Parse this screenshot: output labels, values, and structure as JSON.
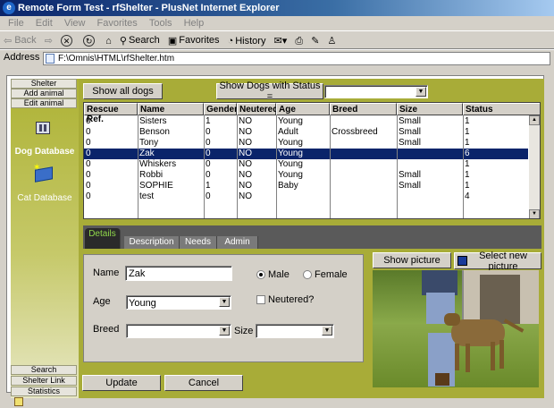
{
  "window": {
    "title": "Remote Form Test - rfShelter - PlusNet Internet Explorer"
  },
  "menu": [
    "File",
    "Edit",
    "View",
    "Favorites",
    "Tools",
    "Help"
  ],
  "toolbar": {
    "back": "Back",
    "search": "Search",
    "favorites": "Favorites",
    "history": "History"
  },
  "address": {
    "label": "Address",
    "value": "F:\\Omnis\\HTML\\rfShelter.htm"
  },
  "nav": {
    "shelter": "Shelter",
    "add_animal": "Add animal",
    "edit_animal": "Edit animal",
    "search": "Search",
    "shelter_link": "Shelter Link",
    "statistics": "Statistics",
    "dog_db": "Dog Database",
    "cat_db": "Cat Database"
  },
  "filters": {
    "show_all": "Show all dogs",
    "show_status": "Show Dogs with Status =",
    "status_value": ""
  },
  "grid": {
    "headers": [
      "Rescue Ref.",
      "Name",
      "Gender",
      "Neutered",
      "Age",
      "Breed",
      "Size",
      "Status"
    ],
    "rows": [
      [
        "0",
        "Sisters",
        "1",
        "NO",
        "Young",
        "",
        "Small",
        "1"
      ],
      [
        "0",
        "Benson",
        "0",
        "NO",
        "Adult",
        "Crossbreed",
        "Small",
        "1"
      ],
      [
        "0",
        "Tony",
        "0",
        "NO",
        "Young",
        "",
        "Small",
        "1"
      ],
      [
        "0",
        "Zak",
        "0",
        "NO",
        "Young",
        "",
        "",
        "6"
      ],
      [
        "0",
        "Whiskers",
        "0",
        "NO",
        "Young",
        "",
        "",
        "1"
      ],
      [
        "0",
        "Robbi",
        "0",
        "NO",
        "Young",
        "",
        "Small",
        "1"
      ],
      [
        "0",
        "SOPHIE",
        "1",
        "NO",
        "Baby",
        "",
        "Small",
        "1"
      ],
      [
        "0",
        "test",
        "0",
        "NO",
        "",
        "",
        "",
        "4"
      ]
    ],
    "selected_index": 3
  },
  "tabs": [
    "Details",
    "Description",
    "Needs",
    "Admin"
  ],
  "form": {
    "name_label": "Name",
    "name_value": "Zak",
    "male": "Male",
    "female": "Female",
    "age_label": "Age",
    "age_value": "Young",
    "neutered": "Neutered?",
    "breed_label": "Breed",
    "breed_value": "",
    "size_label": "Size",
    "size_value": ""
  },
  "picture": {
    "show": "Show picture",
    "select": "Select new picture"
  },
  "actions": {
    "update": "Update",
    "cancel": "Cancel"
  }
}
